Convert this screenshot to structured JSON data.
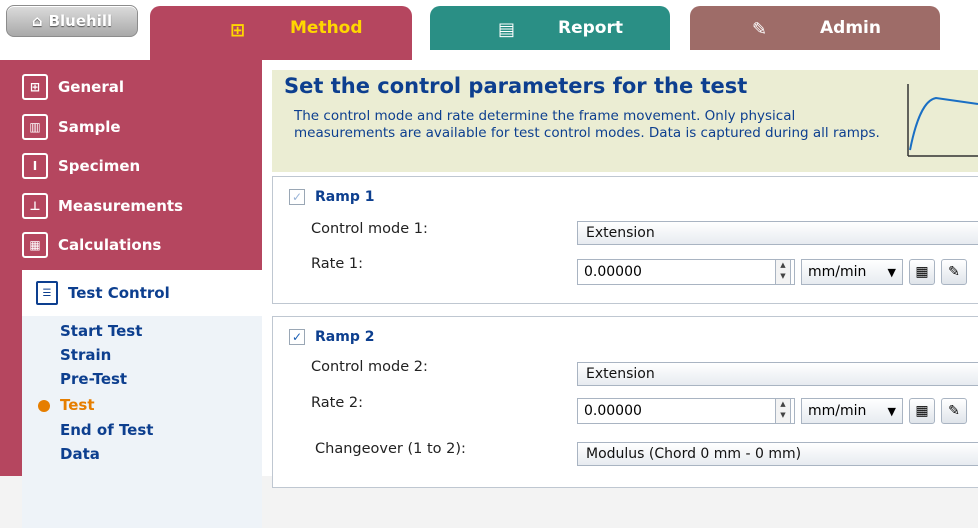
{
  "app": {
    "brand": "Bluehill"
  },
  "tabs": [
    {
      "label": "Method",
      "icon": "tree-icon"
    },
    {
      "label": "Report",
      "icon": "document-icon"
    },
    {
      "label": "Admin",
      "icon": "pencil-icon"
    }
  ],
  "sidebar": {
    "items": [
      {
        "label": "General",
        "icon": "tree-icon"
      },
      {
        "label": "Sample",
        "icon": "sample-icon"
      },
      {
        "label": "Specimen",
        "icon": "specimen-icon"
      },
      {
        "label": "Measurements",
        "icon": "measurements-icon"
      },
      {
        "label": "Calculations",
        "icon": "calculator-icon"
      }
    ],
    "selected": {
      "label": "Test Control",
      "icon": "test-control-icon",
      "sub_items": [
        {
          "label": "Start Test"
        },
        {
          "label": "Strain"
        },
        {
          "label": "Pre-Test"
        },
        {
          "label": "Test",
          "active": true
        },
        {
          "label": "End of Test"
        },
        {
          "label": "Data"
        }
      ]
    }
  },
  "banner": {
    "title": "Set the control parameters for the test",
    "description": "The control mode and rate determine the frame movement. Only physical measurements are available for test control modes. Data is captured during all ramps."
  },
  "ramps": [
    {
      "label": "Ramp 1",
      "checked": true,
      "control_label": "Control mode 1:",
      "control_value": "Extension",
      "rate_label": "Rate 1:",
      "rate_value": "0.00000",
      "unit": "mm/min"
    },
    {
      "label": "Ramp 2",
      "checked": true,
      "control_label": "Control mode 2:",
      "control_value": "Extension",
      "rate_label": "Rate 2:",
      "rate_value": "0.00000",
      "unit": "mm/min",
      "changeover_label": "Changeover (1 to 2):",
      "changeover_value": "Modulus (Chord 0 mm - 0 mm)"
    }
  ],
  "colors": {
    "method": "#b5465f",
    "report": "#2a8f85",
    "admin": "#9e6c68",
    "accent": "#ffd700",
    "active": "#e67e00"
  }
}
